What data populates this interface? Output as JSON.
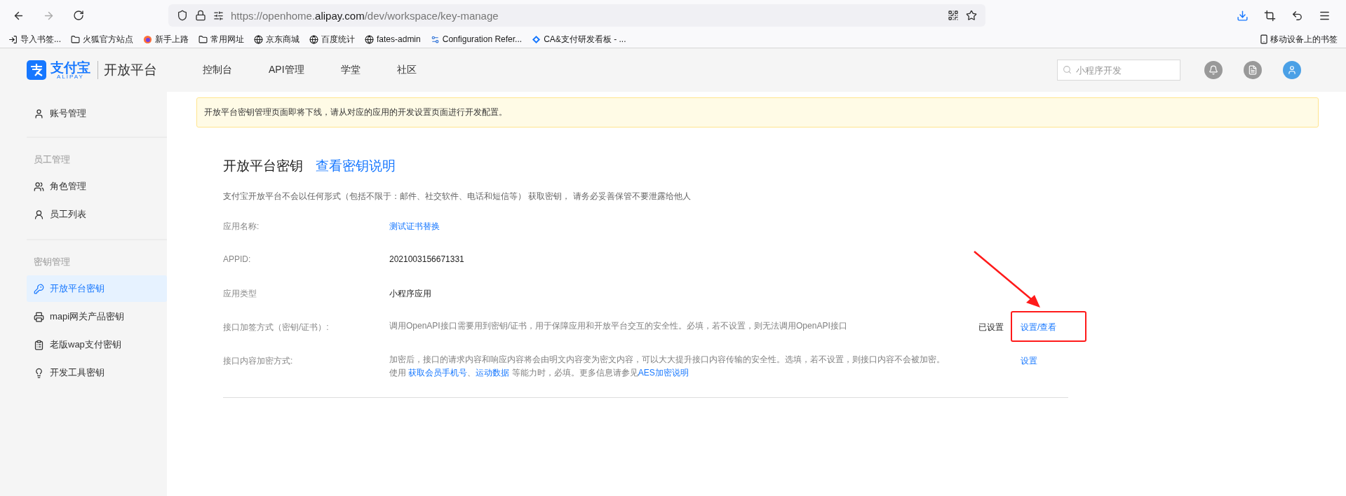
{
  "browser": {
    "url": "https://openhome.**alipay.com**/dev/workspace/key-manage",
    "bookmarks": [
      {
        "label": "导入书签...",
        "kind": "import"
      },
      {
        "label": "火狐官方站点",
        "kind": "folder"
      },
      {
        "label": "新手上路",
        "kind": "firefox"
      },
      {
        "label": "常用网址",
        "kind": "folder"
      },
      {
        "label": "京东商城",
        "kind": "globe"
      },
      {
        "label": "百度统计",
        "kind": "globe"
      },
      {
        "label": "fates-admin",
        "kind": "globe"
      },
      {
        "label": "Configuration Refer...",
        "kind": "config"
      },
      {
        "label": "CA&支付研发看板 - ...",
        "kind": "diamond"
      }
    ],
    "mobile_bookmarks": "移动设备上的书签"
  },
  "header": {
    "logo_cn": "支付宝",
    "logo_en": "ALIPAY",
    "platform": "开放平台",
    "nav": [
      "控制台",
      "API管理",
      "学堂",
      "社区"
    ],
    "search": {
      "placeholder": "小程序开发"
    }
  },
  "sidebar": {
    "sections": [
      {
        "items": [
          {
            "label": "账号管理",
            "kind": "user",
            "selected": false
          }
        ]
      },
      {
        "title": "员工管理",
        "items": [
          {
            "label": "角色管理",
            "kind": "users",
            "selected": false
          },
          {
            "label": "员工列表",
            "kind": "user-list",
            "selected": false
          }
        ]
      },
      {
        "title": "密钥管理",
        "items": [
          {
            "label": "开放平台密钥",
            "kind": "key-circle",
            "selected": true
          },
          {
            "label": "mapi网关产品密钥",
            "kind": "gateway",
            "selected": false
          },
          {
            "label": "老版wap支付密钥",
            "kind": "wap",
            "selected": false
          },
          {
            "label": "开发工具密钥",
            "kind": "bulb",
            "selected": false
          }
        ]
      }
    ]
  },
  "notice": "开放平台密钥管理页面即将下线，请从对应的应用的开发设置页面进行开发配置。",
  "title": "开放平台密钥",
  "title_link": "查看密钥说明",
  "description": "支付宝开放平台不会以任何形式（包括不限于：邮件、社交软件、电话和短信等） 获取密钥， 请务必妥善保管不要泄露给他人",
  "fields": [
    {
      "label": "应用名称:",
      "kind": "link",
      "value": "测试证书替换"
    },
    {
      "label": "APPID:",
      "kind": "plain",
      "value": "2021003156671331"
    },
    {
      "label": "应用类型",
      "kind": "plain",
      "value": "小程序应用"
    },
    {
      "label": "接口加签方式（密钥/证书）:",
      "kind": "note",
      "value": "调用OpenAPI接口需要用到密钥/证书，用于保障应用和开放平台交互的安全性。必填，若不设置，则无法调用OpenAPI接口",
      "status": "已设置",
      "action": "设置/查看",
      "highlighted": true
    },
    {
      "label": "接口内容加密方式:",
      "kind": "note",
      "segments": [
        {
          "text": "加密后，接口的请求内容和响应内容将会由明文内容变为密文内容，可以大大提升接口内容传输的安全性。选填，若不设置，则接口内容不会被加密。使用 ",
          "kind": "text"
        },
        {
          "text": "获取会员手机号",
          "kind": "link"
        },
        {
          "text": "、",
          "kind": "text"
        },
        {
          "text": "运动数据",
          "kind": "link"
        },
        {
          "text": " 等能力时，必填。更多信息请参见",
          "kind": "text"
        },
        {
          "text": "AES加密说明",
          "kind": "link"
        }
      ],
      "action": "设置"
    }
  ]
}
